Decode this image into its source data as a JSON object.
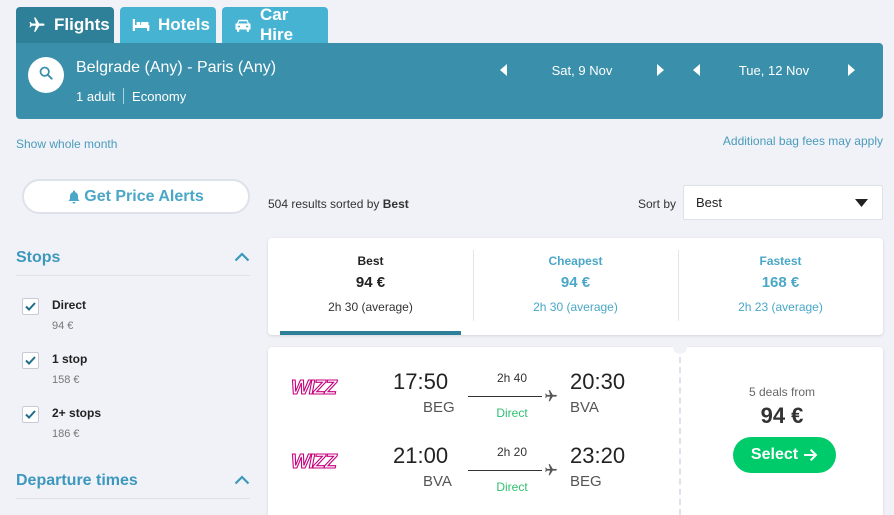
{
  "tabs": [
    {
      "label": "Flights",
      "icon": "plane-icon",
      "active": true
    },
    {
      "label": "Hotels",
      "icon": "bed-icon",
      "active": false
    },
    {
      "label": "Car Hire",
      "icon": "car-icon",
      "active": false
    }
  ],
  "search": {
    "route": "Belgrade (Any) - Paris (Any)",
    "passengers": "1 adult",
    "cabin_class": "Economy",
    "depart_date": "Sat, 9 Nov",
    "return_date": "Tue, 12 Nov"
  },
  "links": {
    "show_whole_month": "Show whole month",
    "bag_fees": "Additional bag fees may apply"
  },
  "price_alert": {
    "label": "Get Price Alerts"
  },
  "filters": {
    "stops": {
      "title": "Stops",
      "options": [
        {
          "label": "Direct",
          "price": "94 €",
          "checked": true
        },
        {
          "label": "1 stop",
          "price": "158 €",
          "checked": true
        },
        {
          "label": "2+ stops",
          "price": "186 €",
          "checked": true
        }
      ]
    },
    "departure_times": {
      "title": "Departure times"
    }
  },
  "results": {
    "count_text": "504 results sorted by",
    "sorted_by": "Best",
    "sort_label": "Sort by",
    "sort_value": "Best"
  },
  "summary": [
    {
      "title": "Best",
      "price": "94 €",
      "avg": "2h 30 (average)",
      "active": true
    },
    {
      "title": "Cheapest",
      "price": "94 €",
      "avg": "2h 30 (average)",
      "active": false
    },
    {
      "title": "Fastest",
      "price": "168 €",
      "avg": "2h 23 (average)",
      "active": false
    }
  ],
  "result_card": {
    "airline": "Wizz Air",
    "legs": [
      {
        "depart_time": "17:50",
        "depart_code": "BEG",
        "duration": "2h 40",
        "stops": "Direct",
        "arrive_time": "20:30",
        "arrive_code": "BVA"
      },
      {
        "depart_time": "21:00",
        "depart_code": "BVA",
        "duration": "2h 20",
        "stops": "Direct",
        "arrive_time": "23:20",
        "arrive_code": "BEG"
      }
    ],
    "deals_text": "5 deals from",
    "price": "94 €",
    "select_label": "Select"
  },
  "colors": {
    "header_blue": "#3a8fab",
    "active_tab": "#2e7f98",
    "inactive_tab": "#47b3d3",
    "select_green": "#00cb6a",
    "direct_green": "#2fbf70",
    "link_blue": "#4aa7c8"
  }
}
